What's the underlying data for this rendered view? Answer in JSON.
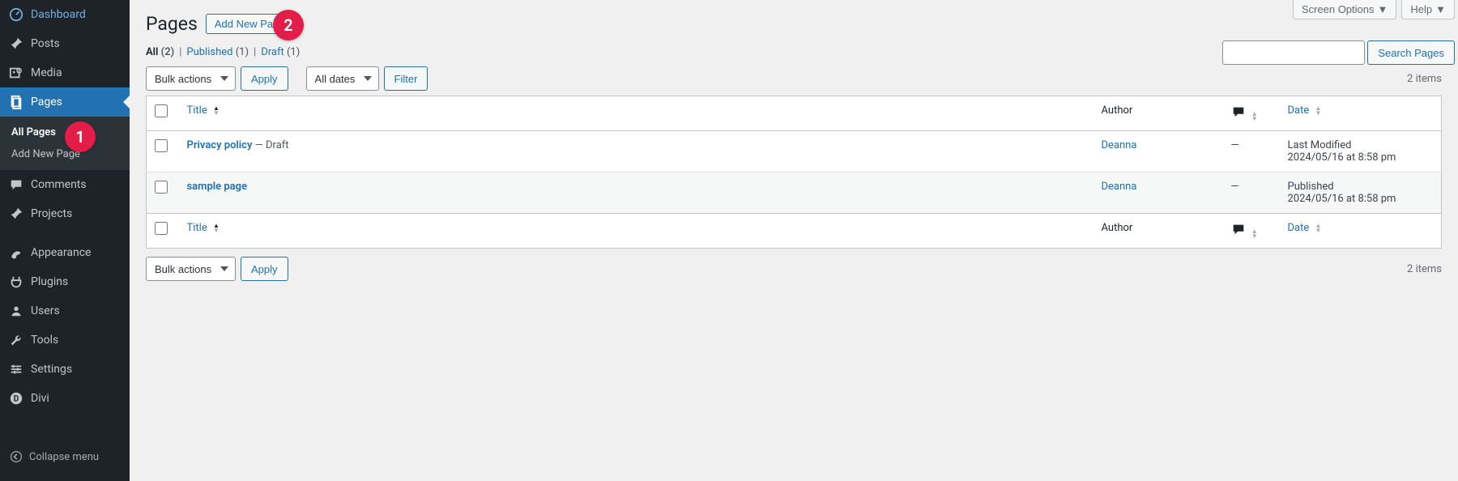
{
  "top": {
    "screen_options": "Screen Options",
    "help": "Help"
  },
  "sidebar": {
    "items": [
      {
        "label": "Dashboard",
        "icon": "dashboard"
      },
      {
        "label": "Posts",
        "icon": "pin"
      },
      {
        "label": "Media",
        "icon": "media"
      },
      {
        "label": "Pages",
        "icon": "pages",
        "current": true
      },
      {
        "label": "Comments",
        "icon": "comments"
      },
      {
        "label": "Projects",
        "icon": "pin"
      },
      {
        "label": "Appearance",
        "icon": "appearance"
      },
      {
        "label": "Plugins",
        "icon": "plugins"
      },
      {
        "label": "Users",
        "icon": "users"
      },
      {
        "label": "Tools",
        "icon": "tools"
      },
      {
        "label": "Settings",
        "icon": "settings"
      },
      {
        "label": "Divi",
        "icon": "divi"
      }
    ],
    "submenu": [
      {
        "label": "All Pages",
        "current": true
      },
      {
        "label": "Add New Page"
      }
    ],
    "collapse": "Collapse menu"
  },
  "annotations": {
    "badge1": "1",
    "badge2": "2"
  },
  "header": {
    "title": "Pages",
    "add_new": "Add New Page"
  },
  "filters": {
    "all_label": "All",
    "all_count": "(2)",
    "published_label": "Published",
    "published_count": "(1)",
    "draft_label": "Draft",
    "draft_count": "(1)",
    "sep": "|"
  },
  "search": {
    "button": "Search Pages"
  },
  "bulk": {
    "label": "Bulk actions",
    "apply": "Apply"
  },
  "datefilter": {
    "label": "All dates",
    "filter": "Filter"
  },
  "count": {
    "items": "2 items"
  },
  "columns": {
    "title": "Title",
    "author": "Author",
    "date": "Date"
  },
  "rows": [
    {
      "title": "Privacy policy",
      "suffix": " — Draft",
      "author": "Deanna",
      "comments": "—",
      "date_line1": "Last Modified",
      "date_line2": "2024/05/16 at 8:58 pm"
    },
    {
      "title": "sample page",
      "suffix": "",
      "author": "Deanna",
      "comments": "—",
      "date_line1": "Published",
      "date_line2": "2024/05/16 at 8:58 pm"
    }
  ]
}
